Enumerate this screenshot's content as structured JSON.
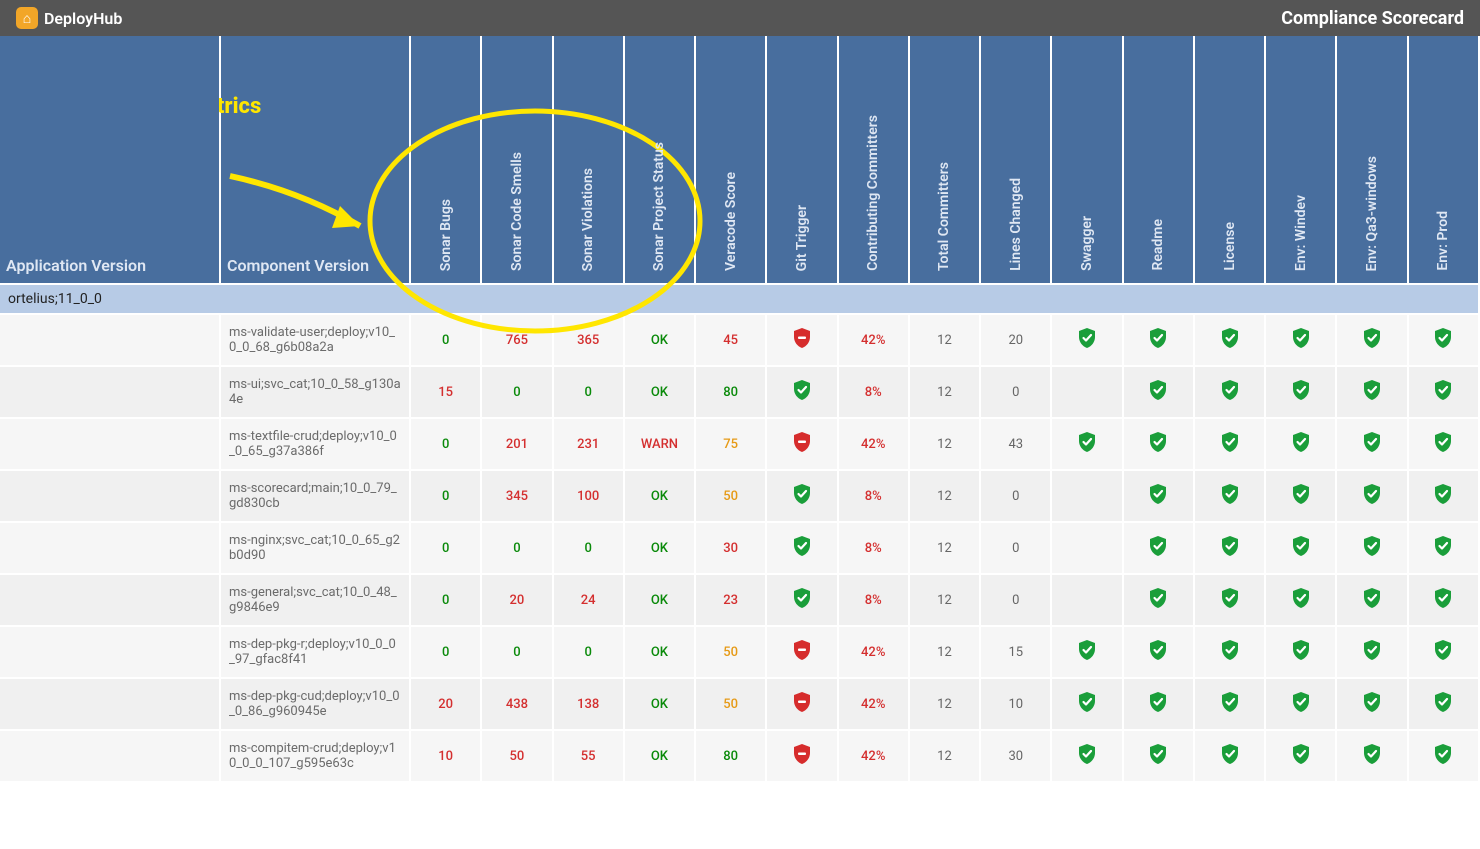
{
  "header": {
    "brand": "DeployHub",
    "brand_icon_glyph": "⌂",
    "page_title": "Compliance Scorecard"
  },
  "annotation": {
    "label": "SonarQube\nMetrics"
  },
  "colors": {
    "header_bg": "#555",
    "table_header_bg": "#486e9e",
    "group_row_bg": "#b7cbe6",
    "value_green": "#0a8a0a",
    "value_red": "#d42f2f",
    "value_orange": "#e69a16",
    "annotation": "#ffe600",
    "shield_green": "#1a9e3a",
    "shield_red": "#d62c2c"
  },
  "columns": [
    {
      "key": "app_version",
      "label": "Application Version",
      "vertical": false
    },
    {
      "key": "component_version",
      "label": "Component Version",
      "vertical": false
    },
    {
      "key": "sonar_bugs",
      "label": "Sonar Bugs",
      "vertical": true
    },
    {
      "key": "sonar_code_smells",
      "label": "Sonar Code Smells",
      "vertical": true
    },
    {
      "key": "sonar_violations",
      "label": "Sonar Violations",
      "vertical": true
    },
    {
      "key": "sonar_project_status",
      "label": "Sonar Project Status",
      "vertical": true
    },
    {
      "key": "veracode_score",
      "label": "Veracode Score",
      "vertical": true
    },
    {
      "key": "git_trigger",
      "label": "Git Trigger",
      "vertical": true
    },
    {
      "key": "contributing_committers",
      "label": "Contributing Committers",
      "vertical": true
    },
    {
      "key": "total_committers",
      "label": "Total Committers",
      "vertical": true
    },
    {
      "key": "lines_changed",
      "label": "Lines Changed",
      "vertical": true
    },
    {
      "key": "swagger",
      "label": "Swagger",
      "vertical": true
    },
    {
      "key": "readme",
      "label": "Readme",
      "vertical": true
    },
    {
      "key": "license",
      "label": "License",
      "vertical": true
    },
    {
      "key": "env_windev",
      "label": "Env: Windev",
      "vertical": true
    },
    {
      "key": "env_qa3_windows",
      "label": "Env: Qa3-windows",
      "vertical": true
    },
    {
      "key": "env_prod",
      "label": "Env: Prod",
      "vertical": true
    }
  ],
  "group": {
    "label": "ortelius;11_0_0"
  },
  "rows": [
    {
      "component_version": "ms-validate-user;deploy;v10_0_0_68_g6b08a2a",
      "sonar_bugs": "0",
      "sonar_bugs_c": "green",
      "sonar_code_smells": "765",
      "sonar_code_smells_c": "red",
      "sonar_violations": "365",
      "sonar_violations_c": "red",
      "sonar_project_status": "OK",
      "sonar_project_status_c": "ok",
      "veracode_score": "45",
      "veracode_score_c": "red",
      "git_trigger": "fail",
      "contributing_committers": "42%",
      "contributing_committers_c": "red",
      "total_committers": "12",
      "lines_changed": "20",
      "swagger": "pass",
      "readme": "pass",
      "license": "pass",
      "env_windev": "pass",
      "env_qa3_windows": "pass",
      "env_prod": "pass"
    },
    {
      "component_version": "ms-ui;svc_cat;10_0_58_g130a4e",
      "sonar_bugs": "15",
      "sonar_bugs_c": "red",
      "sonar_code_smells": "0",
      "sonar_code_smells_c": "green",
      "sonar_violations": "0",
      "sonar_violations_c": "green",
      "sonar_project_status": "OK",
      "sonar_project_status_c": "ok",
      "veracode_score": "80",
      "veracode_score_c": "green",
      "git_trigger": "pass",
      "contributing_committers": "8%",
      "contributing_committers_c": "red",
      "total_committers": "12",
      "lines_changed": "0",
      "swagger": "",
      "readme": "pass",
      "license": "pass",
      "env_windev": "pass",
      "env_qa3_windows": "pass",
      "env_prod": "pass"
    },
    {
      "component_version": "ms-textfile-crud;deploy;v10_0_0_65_g37a386f",
      "sonar_bugs": "0",
      "sonar_bugs_c": "green",
      "sonar_code_smells": "201",
      "sonar_code_smells_c": "red",
      "sonar_violations": "231",
      "sonar_violations_c": "red",
      "sonar_project_status": "WARN",
      "sonar_project_status_c": "warn",
      "veracode_score": "75",
      "veracode_score_c": "orange",
      "git_trigger": "fail",
      "contributing_committers": "42%",
      "contributing_committers_c": "red",
      "total_committers": "12",
      "lines_changed": "43",
      "swagger": "pass",
      "readme": "pass",
      "license": "pass",
      "env_windev": "pass",
      "env_qa3_windows": "pass",
      "env_prod": "pass"
    },
    {
      "component_version": "ms-scorecard;main;10_0_79_gd830cb",
      "sonar_bugs": "0",
      "sonar_bugs_c": "green",
      "sonar_code_smells": "345",
      "sonar_code_smells_c": "red",
      "sonar_violations": "100",
      "sonar_violations_c": "red",
      "sonar_project_status": "OK",
      "sonar_project_status_c": "ok",
      "veracode_score": "50",
      "veracode_score_c": "orange",
      "git_trigger": "pass",
      "contributing_committers": "8%",
      "contributing_committers_c": "red",
      "total_committers": "12",
      "lines_changed": "0",
      "swagger": "",
      "readme": "pass",
      "license": "pass",
      "env_windev": "pass",
      "env_qa3_windows": "pass",
      "env_prod": "pass"
    },
    {
      "component_version": "ms-nginx;svc_cat;10_0_65_g2b0d90",
      "sonar_bugs": "0",
      "sonar_bugs_c": "green",
      "sonar_code_smells": "0",
      "sonar_code_smells_c": "green",
      "sonar_violations": "0",
      "sonar_violations_c": "green",
      "sonar_project_status": "OK",
      "sonar_project_status_c": "ok",
      "veracode_score": "30",
      "veracode_score_c": "red",
      "git_trigger": "pass",
      "contributing_committers": "8%",
      "contributing_committers_c": "red",
      "total_committers": "12",
      "lines_changed": "0",
      "swagger": "",
      "readme": "pass",
      "license": "pass",
      "env_windev": "pass",
      "env_qa3_windows": "pass",
      "env_prod": "pass"
    },
    {
      "component_version": "ms-general;svc_cat;10_0_48_g9846e9",
      "sonar_bugs": "0",
      "sonar_bugs_c": "green",
      "sonar_code_smells": "20",
      "sonar_code_smells_c": "red",
      "sonar_violations": "24",
      "sonar_violations_c": "red",
      "sonar_project_status": "OK",
      "sonar_project_status_c": "ok",
      "veracode_score": "23",
      "veracode_score_c": "red",
      "git_trigger": "pass",
      "contributing_committers": "8%",
      "contributing_committers_c": "red",
      "total_committers": "12",
      "lines_changed": "0",
      "swagger": "",
      "readme": "pass",
      "license": "pass",
      "env_windev": "pass",
      "env_qa3_windows": "pass",
      "env_prod": "pass"
    },
    {
      "component_version": "ms-dep-pkg-r;deploy;v10_0_0_97_gfac8f41",
      "sonar_bugs": "0",
      "sonar_bugs_c": "green",
      "sonar_code_smells": "0",
      "sonar_code_smells_c": "green",
      "sonar_violations": "0",
      "sonar_violations_c": "green",
      "sonar_project_status": "OK",
      "sonar_project_status_c": "ok",
      "veracode_score": "50",
      "veracode_score_c": "orange",
      "git_trigger": "fail",
      "contributing_committers": "42%",
      "contributing_committers_c": "red",
      "total_committers": "12",
      "lines_changed": "15",
      "swagger": "pass",
      "readme": "pass",
      "license": "pass",
      "env_windev": "pass",
      "env_qa3_windows": "pass",
      "env_prod": "pass"
    },
    {
      "component_version": "ms-dep-pkg-cud;deploy;v10_0_0_86_g960945e",
      "sonar_bugs": "20",
      "sonar_bugs_c": "red",
      "sonar_code_smells": "438",
      "sonar_code_smells_c": "red",
      "sonar_violations": "138",
      "sonar_violations_c": "red",
      "sonar_project_status": "OK",
      "sonar_project_status_c": "ok",
      "veracode_score": "50",
      "veracode_score_c": "orange",
      "git_trigger": "fail",
      "contributing_committers": "42%",
      "contributing_committers_c": "red",
      "total_committers": "12",
      "lines_changed": "10",
      "swagger": "pass",
      "readme": "pass",
      "license": "pass",
      "env_windev": "pass",
      "env_qa3_windows": "pass",
      "env_prod": "pass"
    },
    {
      "component_version": "ms-compitem-crud;deploy;v10_0_0_107_g595e63c",
      "sonar_bugs": "10",
      "sonar_bugs_c": "red",
      "sonar_code_smells": "50",
      "sonar_code_smells_c": "red",
      "sonar_violations": "55",
      "sonar_violations_c": "red",
      "sonar_project_status": "OK",
      "sonar_project_status_c": "ok",
      "veracode_score": "80",
      "veracode_score_c": "green",
      "git_trigger": "fail",
      "contributing_committers": "42%",
      "contributing_committers_c": "red",
      "total_committers": "12",
      "lines_changed": "30",
      "swagger": "pass",
      "readme": "pass",
      "license": "pass",
      "env_windev": "pass",
      "env_qa3_windows": "pass",
      "env_prod": "pass"
    }
  ]
}
